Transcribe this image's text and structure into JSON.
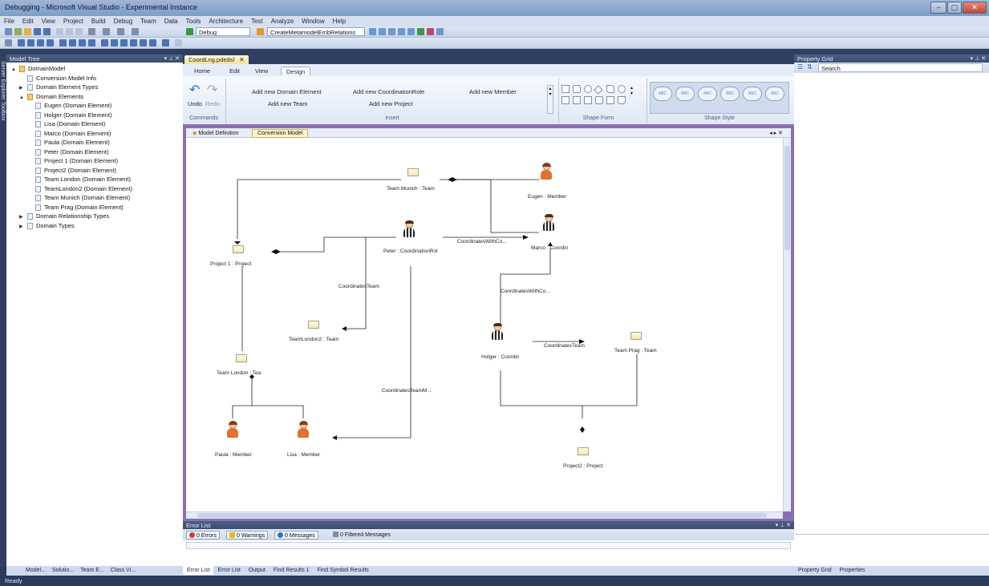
{
  "window": {
    "title": "Debugging - Microsoft Visual Studio - Experimental Instance",
    "controls": [
      "–",
      "▢",
      "✕"
    ]
  },
  "menu": [
    "File",
    "Edit",
    "View",
    "Project",
    "Build",
    "Debug",
    "Team",
    "Data",
    "Tools",
    "Architecture",
    "Test",
    "Analyze",
    "Window",
    "Help"
  ],
  "toolbar": {
    "config": "Debug",
    "action": "CreateMetamodelEmbRelations"
  },
  "model_tree": {
    "title": "Model Tree",
    "items": [
      {
        "label": "DomainModel",
        "level": 0,
        "expand": "▲",
        "type": "folder"
      },
      {
        "label": "Conversion Model Info",
        "level": 1,
        "expand": "",
        "type": "item"
      },
      {
        "label": "Domain Element Types",
        "level": 1,
        "expand": "▶",
        "type": "item"
      },
      {
        "label": "Domain Elements",
        "level": 1,
        "expand": "▲",
        "type": "folder"
      },
      {
        "label": "Eugen (Domain Element)",
        "level": 2,
        "expand": "",
        "type": "item"
      },
      {
        "label": "Holger (Domain Element)",
        "level": 2,
        "expand": "",
        "type": "item"
      },
      {
        "label": "Lisa (Domain Element)",
        "level": 2,
        "expand": "",
        "type": "item"
      },
      {
        "label": "Marco (Domain Element)",
        "level": 2,
        "expand": "",
        "type": "item"
      },
      {
        "label": "Paula (Domain Element)",
        "level": 2,
        "expand": "",
        "type": "item"
      },
      {
        "label": "Peter (Domain Element)",
        "level": 2,
        "expand": "",
        "type": "item"
      },
      {
        "label": "Project 1 (Domain Element)",
        "level": 2,
        "expand": "",
        "type": "item"
      },
      {
        "label": "Project2 (Domain Element)",
        "level": 2,
        "expand": "",
        "type": "item"
      },
      {
        "label": "Team London (Domain Element)",
        "level": 2,
        "expand": "",
        "type": "item"
      },
      {
        "label": "TeamLondon2 (Domain Element)",
        "level": 2,
        "expand": "",
        "type": "item"
      },
      {
        "label": "Team Munich (Domain Element)",
        "level": 2,
        "expand": "",
        "type": "item"
      },
      {
        "label": "Team Prag (Domain Element)",
        "level": 2,
        "expand": "",
        "type": "item"
      },
      {
        "label": "Domain Relationship Types",
        "level": 1,
        "expand": "▶",
        "type": "item"
      },
      {
        "label": "Domain Types",
        "level": 1,
        "expand": "▶",
        "type": "item"
      }
    ],
    "side_tabs": "Server Explorer  Toolbox",
    "bottom_tabs": [
      "Model...",
      "Solutio...",
      "Team E...",
      "Class Vi..."
    ]
  },
  "document": {
    "tab": "CoordLng.pdedsl",
    "ribbon_tabs": [
      "Home",
      "Edit",
      "View",
      "Design"
    ],
    "active_ribbon_tab": "Design",
    "commands": {
      "undo": "Undo",
      "redo": "Redo",
      "group": "Commands"
    },
    "insert": {
      "buttons": [
        "Add new Domain Element",
        "Add new CoordinationRole",
        "Add new Member",
        "Add new Team",
        "Add new Project"
      ],
      "group": "Insert"
    },
    "shape_form_group": "Shape Form",
    "shape_style_group": "Shape Style",
    "style_chip": "ABC",
    "designer_tabs": [
      "Model Definition",
      "Conversion Model"
    ]
  },
  "diagram": {
    "nodes": [
      {
        "id": "munich",
        "label": "Team Munich : Team",
        "kind": "team"
      },
      {
        "id": "eugen",
        "label": "Eugen : Member",
        "kind": "member"
      },
      {
        "id": "peter",
        "label": "Peter : CoordinationRol",
        "kind": "coord"
      },
      {
        "id": "marco",
        "label": "Marco : Coordin",
        "kind": "coord"
      },
      {
        "id": "project1",
        "label": "Project 1 : Project",
        "kind": "team"
      },
      {
        "id": "teamlondon2",
        "label": "TeamLondon2 : Team",
        "kind": "team"
      },
      {
        "id": "holger",
        "label": "Holger : Coordin",
        "kind": "coord"
      },
      {
        "id": "teamprag",
        "label": "Team Prag : Team",
        "kind": "team"
      },
      {
        "id": "teamlondon",
        "label": "Team London : Tea",
        "kind": "team"
      },
      {
        "id": "paula",
        "label": "Paula : Member",
        "kind": "member"
      },
      {
        "id": "lisa",
        "label": "Lisa : Member",
        "kind": "member"
      },
      {
        "id": "project2",
        "label": "Project2 : Project",
        "kind": "team"
      }
    ],
    "edge_labels": {
      "coordinates_with_1": "CoordinatesWithCo...",
      "coordinates_team_1": "CoordinatesTeam",
      "coordinates_with_2": "CoordinatesWithCo...",
      "coordinates_team_2": "CoordinatesTeam",
      "coordinates_team_m": "CoordinatesTeamM..."
    }
  },
  "error_list": {
    "title": "Error List",
    "errors": "0 Errors",
    "warnings": "0 Warnings",
    "messages": "0 Messages",
    "filtered": "0 Filtered Messages"
  },
  "bottom_tabs": [
    "Error List",
    "Error List",
    "Output",
    "Find Results 1",
    "Find Symbol Results"
  ],
  "property_grid": {
    "title": "Property Grid",
    "search": "Search",
    "tabs": [
      "Property Grid",
      "Properties"
    ]
  },
  "status": "Ready",
  "colors": {
    "chrome": "#2e3f60",
    "ribbon": "#d5e0f0",
    "doc_tab": "#f6e19e"
  }
}
